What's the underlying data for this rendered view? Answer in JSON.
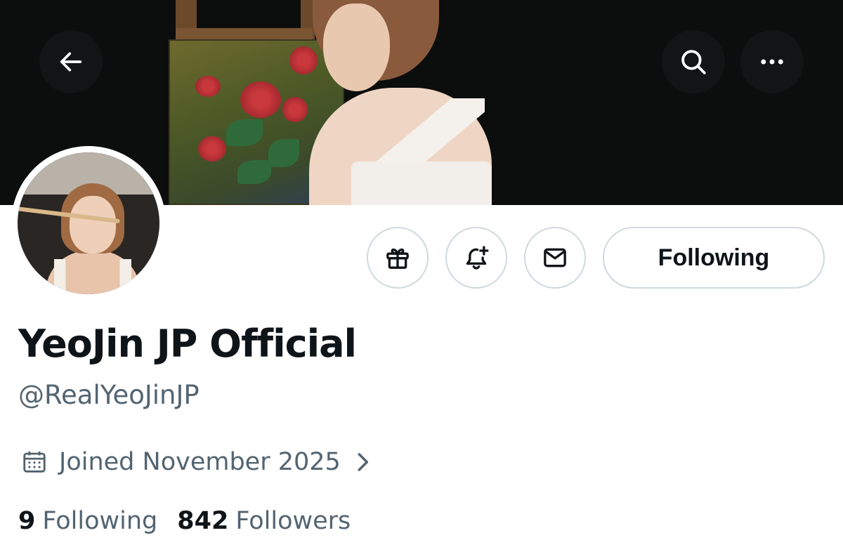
{
  "header": {
    "back_icon": "arrow-left-icon",
    "search_icon": "search-icon",
    "more_icon": "more-horizontal-icon",
    "icon_color": "#ffffff",
    "button_bg": "#141618"
  },
  "actions": {
    "gift_icon": "gift-icon",
    "notify_icon": "bell-plus-icon",
    "message_icon": "mail-icon",
    "follow_label": "Following"
  },
  "profile": {
    "display_name": "YeoJin JP Official",
    "handle": "@RealYeoJinJP",
    "joined": "Joined November 2025",
    "calendar_icon": "calendar-icon",
    "chevron_icon": "chevron-right-icon",
    "following_count": "9",
    "following_label": "Following",
    "followers_count": "842",
    "followers_label": "Followers"
  },
  "colors": {
    "text_primary": "#0f1419",
    "text_secondary": "#536471",
    "border": "#cfd9de"
  }
}
